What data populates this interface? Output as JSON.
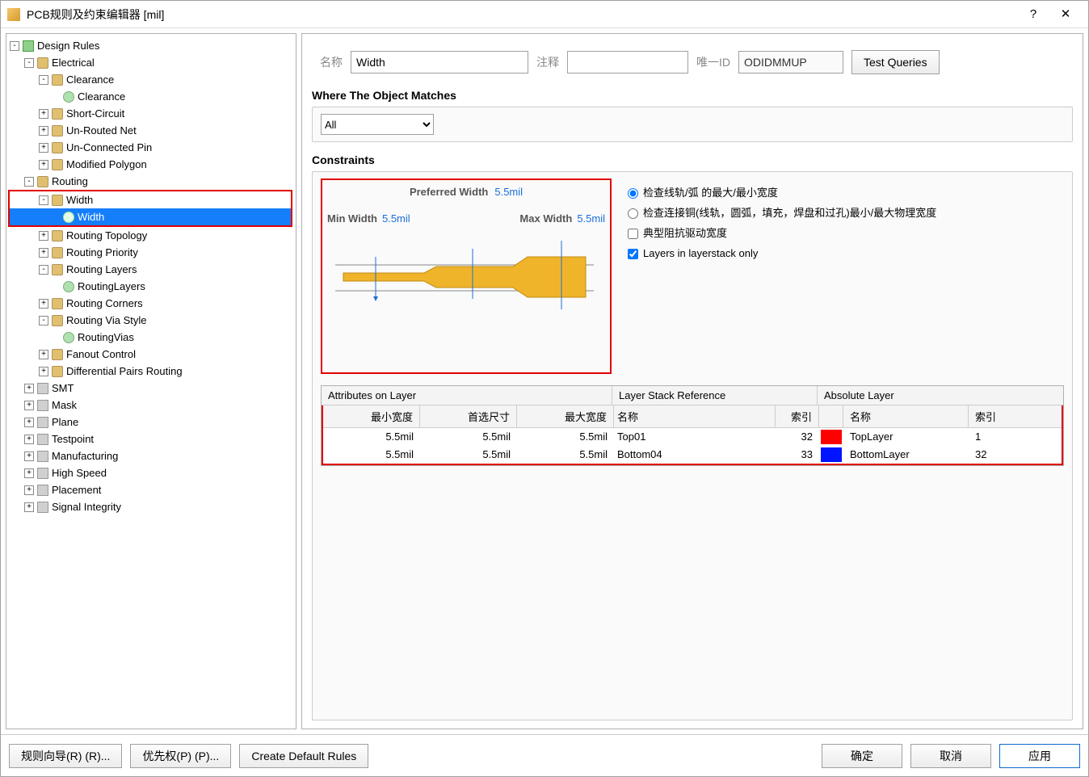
{
  "title": "PCB规则及约束编辑器 [mil]",
  "tree": {
    "root": "Design Rules",
    "electrical": "Electrical",
    "clearance": "Clearance",
    "clearance2": "Clearance",
    "short": "Short-Circuit",
    "unrouted": "Un-Routed Net",
    "unconnected": "Un-Connected Pin",
    "modpoly": "Modified Polygon",
    "routing": "Routing",
    "width": "Width",
    "width2": "Width",
    "rtopo": "Routing Topology",
    "rprio": "Routing Priority",
    "rlayers": "Routing Layers",
    "rlayers2": "RoutingLayers",
    "rcorners": "Routing Corners",
    "rvia": "Routing Via Style",
    "rvias2": "RoutingVias",
    "fanout": "Fanout Control",
    "diffpair": "Differential Pairs Routing",
    "smt": "SMT",
    "mask": "Mask",
    "plane": "Plane",
    "testpoint": "Testpoint",
    "mfg": "Manufacturing",
    "hispeed": "High Speed",
    "placement": "Placement",
    "sigint": "Signal Integrity"
  },
  "form": {
    "name_lbl": "名称",
    "name_val": "Width",
    "comment_lbl": "注释",
    "comment_val": "",
    "uid_lbl": "唯一ID",
    "uid_val": "ODIDMMUP",
    "test_queries": "Test Queries"
  },
  "matches": {
    "title": "Where The Object Matches",
    "all": "All"
  },
  "constraints": {
    "title": "Constraints",
    "pref_lbl": "Preferred Width",
    "pref_val": "5.5mil",
    "min_lbl": "Min Width",
    "min_val": "5.5mil",
    "max_lbl": "Max Width",
    "max_val": "5.5mil",
    "opt1": "检查线轨/弧 的最大/最小宽度",
    "opt2": "检查连接铜(线轨，圆弧，填充，焊盘和过孔)最小/最大物理宽度",
    "chk1": "典型阻抗驱动宽度",
    "chk2": "Layers in layerstack only"
  },
  "grid": {
    "h1a": "Attributes on Layer",
    "h1b": "Layer Stack Reference",
    "h1c": "Absolute Layer",
    "h2_min": "最小宽度",
    "h2_pref": "首选尺寸",
    "h2_max": "最大宽度",
    "h2_name": "名称",
    "h2_idx": "索引",
    "h2_name2": "名称",
    "h2_idx2": "索引",
    "rows": [
      {
        "min": "5.5mil",
        "pref": "5.5mil",
        "max": "5.5mil",
        "lname": "Top01",
        "idx": "32",
        "color": "#ff0000",
        "abs": "TopLayer",
        "aidx": "1"
      },
      {
        "min": "5.5mil",
        "pref": "5.5mil",
        "max": "5.5mil",
        "lname": "Bottom04",
        "idx": "33",
        "color": "#0014ff",
        "abs": "BottomLayer",
        "aidx": "32"
      }
    ]
  },
  "footer": {
    "wizard": "规则向导(R) (R)...",
    "priority": "优先权(P) (P)...",
    "defaults": "Create Default Rules",
    "ok": "确定",
    "cancel": "取消",
    "apply": "应用"
  }
}
